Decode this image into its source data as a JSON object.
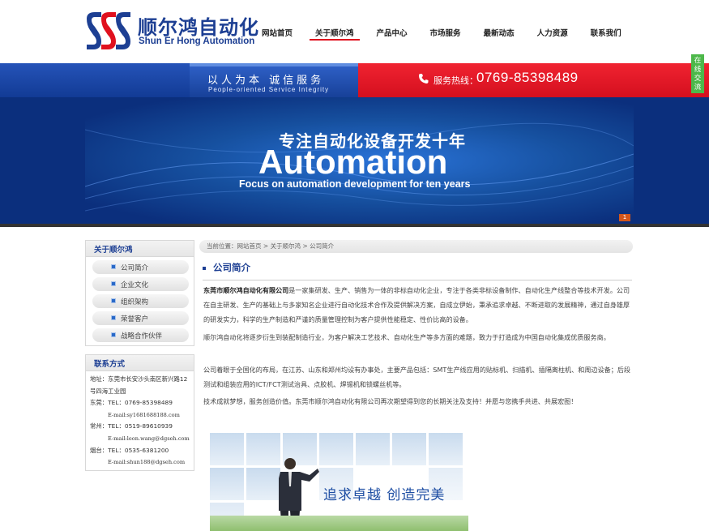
{
  "header": {
    "logo_cn": "顺尔鸿自动化",
    "logo_en": "Shun Er Hong Automation",
    "nav": [
      "网站首页",
      "关于顺尔鸿",
      "产品中心",
      "市场服务",
      "最新动态",
      "人力资源",
      "联系我们"
    ],
    "active_nav": "关于顺尔鸿"
  },
  "slogan": {
    "cn": "以人为本   诚信服务",
    "en": "People-oriented Service Integrity",
    "hotline_label": "服务热线：",
    "hotline_number": "0769-85398489"
  },
  "online_chat": "在线交流",
  "banner": {
    "cn": "专注自动化设备开发十年",
    "en_big": "Automation",
    "en_small": "Focus on automation  development for ten years",
    "dot": "1"
  },
  "sidebar": {
    "about_title": "关于顺尔鸿",
    "items": [
      "公司简介",
      "企业文化",
      "组织架构",
      "荣誉客户",
      "战略合作伙伴"
    ],
    "contact_title": "联系方式",
    "contact": {
      "address": "地址：东莞市长安沙头南区新兴路12号四海工业园",
      "dongguan_tel": "东莞：TEL：0769-85398489",
      "dongguan_email": "E-mail:sy1681688188.com",
      "changzhou_tel": "常州：TEL：0519-89610939",
      "changzhou_email": "E-mail:leon.wang@dgseh.com",
      "yantai_tel": "烟台：TEL：0535-6381200",
      "yantai_email": "E-mail:shun188@dgseh.com"
    }
  },
  "breadcrumb": {
    "prefix": "当前位置：",
    "home": "网站首页",
    "sep1": " > ",
    "section": "关于顺尔鸿",
    "sep2": " > ",
    "current": "公司简介"
  },
  "main": {
    "title": "公司简介",
    "p1_bold": "东莞市顺尔鸿自动化有限公司",
    "p1_rest": "是一家集研发、生产、销售为一体的非标自动化企业，专注于各类非标设备制作、自动化生产线整合等技术开发。公司在自主研发、生产的基础上与多家知名企业进行自动化技术合作及提供解决方案，自成立伊始，秉承追求卓越、不断进取的发展精神，通过自身雄厚的研发实力，科学的生产制造和严谨的质量管理控制为客户提供性能稳定、性价比高的设备。",
    "p2": "顺尔鸿自动化将逐步衍生到装配制造行业，为客户解决工艺技术、自动化生产等多方面的难题，致力于打造成为中国自动化集成优质服务商。",
    "p3": "公司着眼于全国化的布局，在江苏、山东和郑州均设有办事处，主要产品包括：SMT生产线应用的贴标机、扫描机、插隔离柱机、和周边设备；后段测试和组装应用的ICT/FCT测试治具、点胶机、焊锡机和锁螺丝机等。",
    "p4": "技术成就梦想，服务创造价值。东莞市顺尔鸿自动化有限公司再次期望得到您的长期关注及支持！并愿与您携手共进、共展宏图！",
    "image_slogan": "追求卓越 创造完美"
  },
  "colors": {
    "brand_blue": "#1d3f93",
    "hotline_red": "#e0111e",
    "bar_blue": "#1a47a6",
    "chat_green": "#4db84a"
  }
}
